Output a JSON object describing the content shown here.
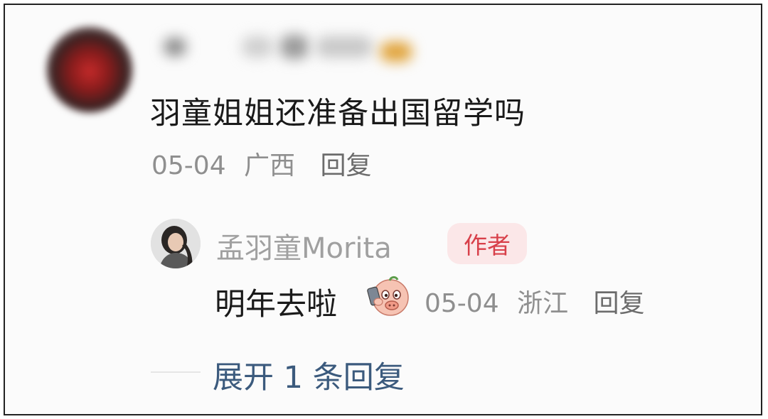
{
  "comment": {
    "text": "羽童姐姐还准备出国留学吗",
    "date": "05-04",
    "location": "广西",
    "reply_label": "回复"
  },
  "reply": {
    "author_name": "孟羽童Morita",
    "author_badge": "作者",
    "text": "明年去啦",
    "emoji_icon": "pig-face-emoji-icon",
    "date": "05-04",
    "location": "浙江",
    "reply_label": "回复"
  },
  "expand_label": "展开 1 条回复",
  "colors": {
    "primary_text": "#1a1a1a",
    "secondary_text": "#8f8f8f",
    "badge_bg": "#fbe7e8",
    "badge_text": "#d8404a",
    "expand_link": "#3b5a7d"
  }
}
